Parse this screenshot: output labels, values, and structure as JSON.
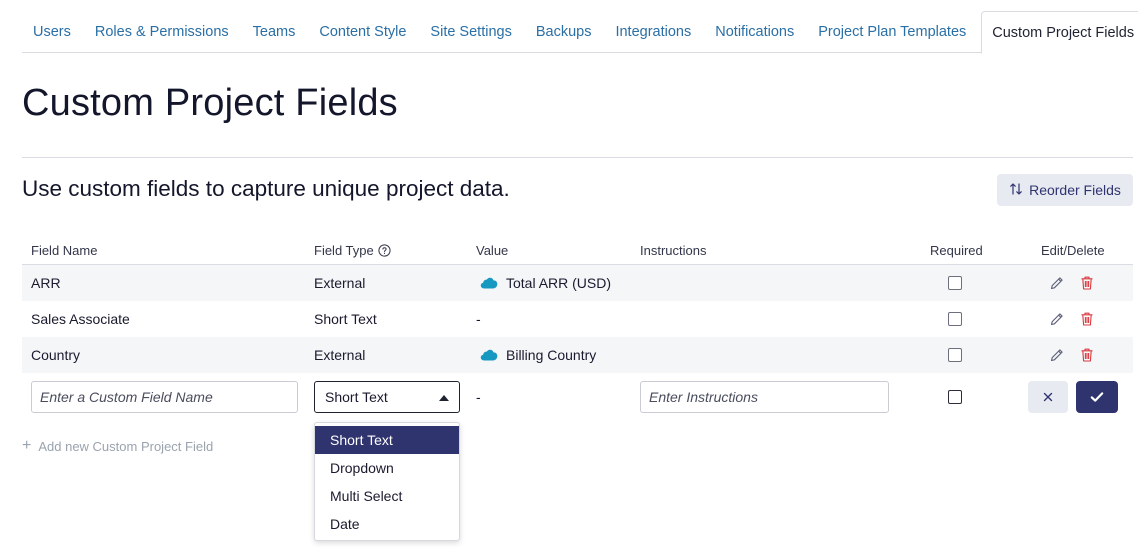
{
  "tabs": [
    {
      "label": "Users"
    },
    {
      "label": "Roles & Permissions"
    },
    {
      "label": "Teams"
    },
    {
      "label": "Content Style"
    },
    {
      "label": "Site Settings"
    },
    {
      "label": "Backups"
    },
    {
      "label": "Integrations"
    },
    {
      "label": "Notifications"
    },
    {
      "label": "Project Plan Templates"
    },
    {
      "label": "Custom Project Fields",
      "active": true
    }
  ],
  "page": {
    "title": "Custom Project Fields",
    "subtitle": "Use custom fields to capture unique project data.",
    "reorder_label": "Reorder Fields"
  },
  "table": {
    "headers": {
      "field_name": "Field Name",
      "field_type": "Field Type",
      "value": "Value",
      "instructions": "Instructions",
      "required": "Required",
      "edit_delete": "Edit/Delete"
    },
    "rows": [
      {
        "name": "ARR",
        "type": "External",
        "value": "Total ARR (USD)",
        "value_icon": "salesforce-icon",
        "required": false
      },
      {
        "name": "Sales Associate",
        "type": "Short Text",
        "value": "-",
        "required": false
      },
      {
        "name": "Country",
        "type": "External",
        "value": "Billing Country",
        "value_icon": "salesforce-icon",
        "required": false
      }
    ]
  },
  "new_row": {
    "name_placeholder": "Enter a Custom Field Name",
    "type_selected": "Short Text",
    "value": "-",
    "instructions_placeholder": "Enter Instructions",
    "required": false
  },
  "type_options": [
    "Short Text",
    "Dropdown",
    "Multi Select",
    "Date"
  ],
  "add_label": "Add new Custom Project Field",
  "colors": {
    "accent": "#2f336e",
    "link": "#2a6fa5",
    "delete": "#d9393f",
    "salesforce": "#1798c1"
  }
}
